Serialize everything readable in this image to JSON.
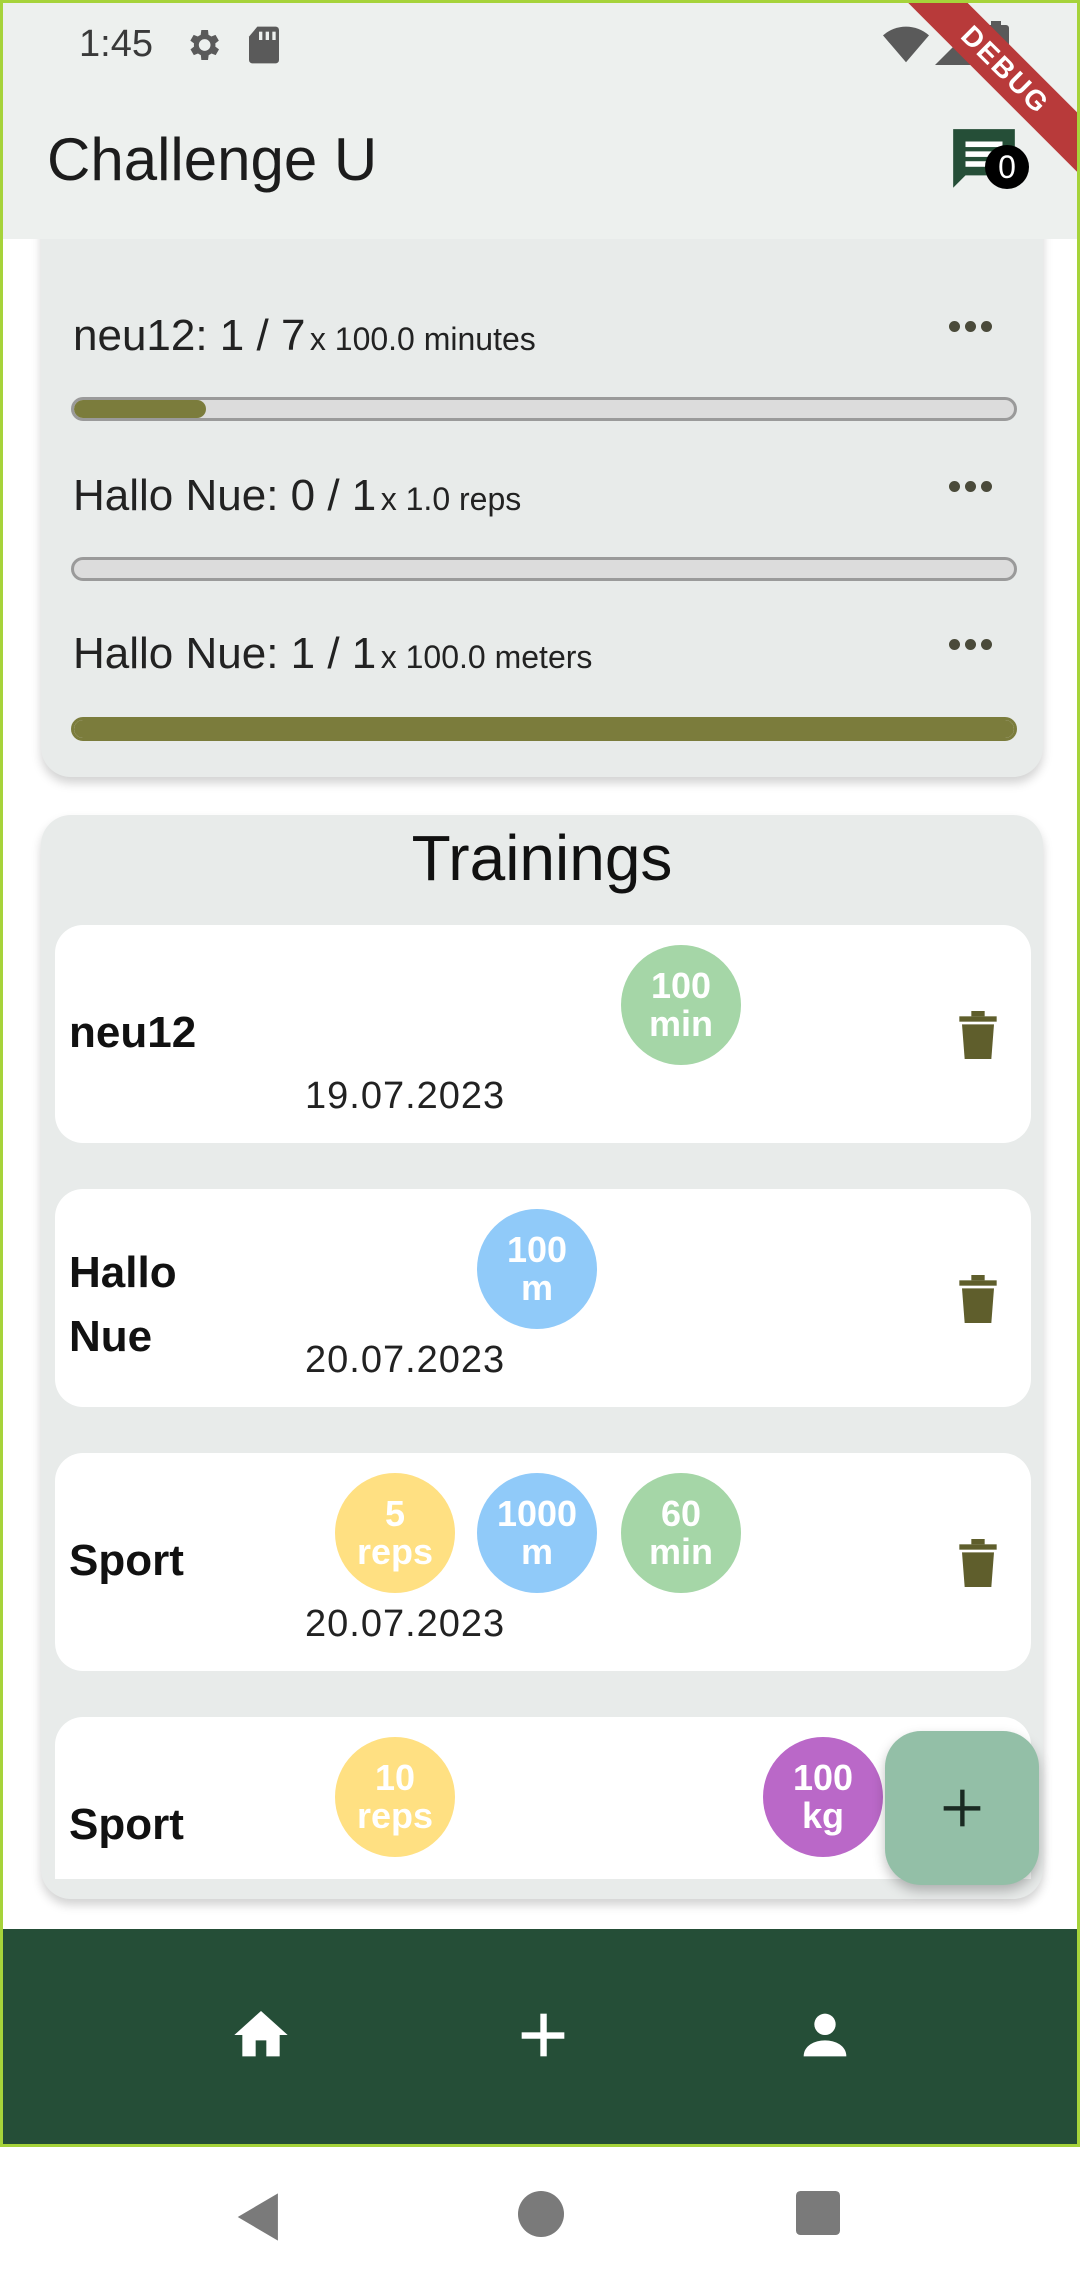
{
  "status_bar": {
    "time": "1:45"
  },
  "debug_ribbon": "DEBUG",
  "app_bar": {
    "title": "Challenge U",
    "chat_badge": "0"
  },
  "challenges": [
    {
      "name": "neu12: 1 / 7",
      "unit": "x 100.0 minutes",
      "progress": 0.14
    },
    {
      "name": "Hallo Nue: 0 / 1",
      "unit": "x 1.0 reps",
      "progress": 0.0
    },
    {
      "name": "Hallo Nue: 1 / 1",
      "unit": "x 100.0 meters",
      "progress": 1.0
    }
  ],
  "trainings": {
    "title": "Trainings",
    "items": [
      {
        "name": "neu12",
        "date": "19.07.2023",
        "bubbles": [
          {
            "value": "100",
            "unit": "min",
            "color": "#a5d6a7"
          }
        ]
      },
      {
        "name": "Hallo Nue",
        "date": "20.07.2023",
        "bubbles": [
          {
            "value": "100",
            "unit": "m",
            "color": "#90caf9"
          }
        ]
      },
      {
        "name": "Sport",
        "date": "20.07.2023",
        "bubbles": [
          {
            "value": "5",
            "unit": "reps",
            "color": "#ffe082"
          },
          {
            "value": "1000",
            "unit": "m",
            "color": "#90caf9"
          },
          {
            "value": "60",
            "unit": "min",
            "color": "#a5d6a7"
          }
        ]
      },
      {
        "name": "Sport",
        "date": "",
        "bubbles": [
          {
            "value": "10",
            "unit": "reps",
            "color": "#ffe082"
          },
          {
            "value": "100",
            "unit": "kg",
            "color": "#ba68c8"
          }
        ]
      }
    ]
  },
  "colors": {
    "accent_dark": "#254e37",
    "progress_fill": "#7b7c3c",
    "fab": "#93bfa7"
  },
  "icons": {
    "fab": "add-icon",
    "nav": [
      "home-icon",
      "add-icon",
      "person-icon"
    ],
    "system_nav": [
      "back-icon",
      "home-circle-icon",
      "recents-icon"
    ]
  }
}
